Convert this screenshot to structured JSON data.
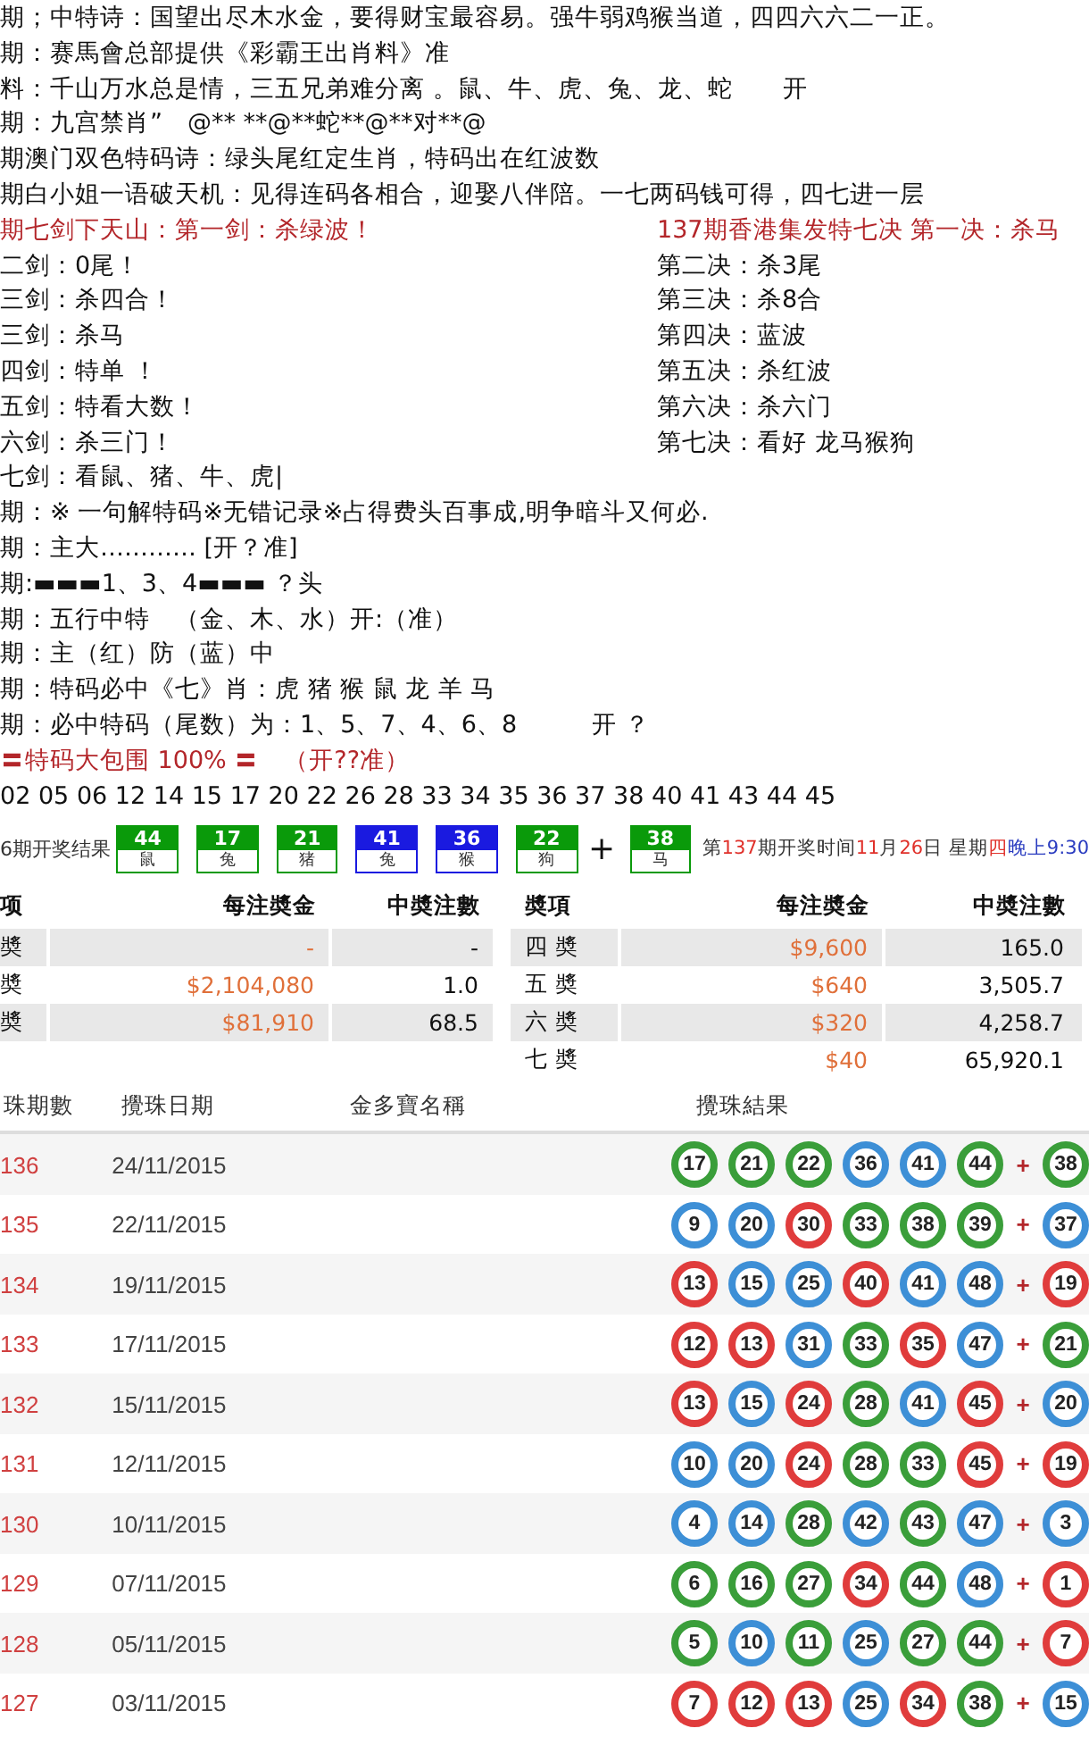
{
  "lines": [
    {
      "kind": "text",
      "text": "期；中特诗：国望出尽木水金，要得财宝最容易。强牛弱鸡猴当道，四四六六二一正。"
    },
    {
      "kind": "text",
      "text": "期：赛馬會总部提供《彩霸王出肖料》准"
    },
    {
      "kind": "text",
      "text": "料：千山万水总是情，三五兄弟难分离 。鼠、牛、虎、兔、龙、蛇　　开"
    },
    {
      "kind": "text",
      "text": "期：九宫禁肖”　@** **@**蛇**@**对**@"
    },
    {
      "kind": "text",
      "text": "期澳门双色特码诗：绿头尾红定生肖，特码出在红波数"
    },
    {
      "kind": "text",
      "text": "期白小姐一语破天机：见得连码各相合，迎娶八伴陪。一七两码钱可得，四七进一层"
    },
    {
      "kind": "alert_pair",
      "left": "期七剑下天山：第一剑：杀绿波！",
      "right": "137期香港集发特七决 第一决：杀马"
    },
    {
      "kind": "pair",
      "left": "二剑：0尾！",
      "right": "第二决：杀3尾"
    },
    {
      "kind": "pair",
      "left": "三剑：杀四合！",
      "right": "第三决：杀8合"
    },
    {
      "kind": "pair",
      "left": "三剑：杀马",
      "right": "第四决：蓝波"
    },
    {
      "kind": "pair",
      "left": "四剑：特单 ！",
      "right": "第五决：杀红波"
    },
    {
      "kind": "pair",
      "left": "五剑：特看大数！",
      "right": "第六决：杀六门"
    },
    {
      "kind": "pair",
      "left": "六剑：杀三门！",
      "right": "第七决：看好 龙马猴狗"
    },
    {
      "kind": "text",
      "text": "七剑：看鼠、猪、牛、虎|"
    },
    {
      "kind": "text",
      "text": "期：※ 一句解特码※无错记录※占得费头百事成,明争暗斗又何必."
    },
    {
      "kind": "text",
      "text": "期：主大………… [开？准]"
    },
    {
      "kind": "text",
      "text": "期:▬▬▬1、3、4▬▬▬ ？头"
    },
    {
      "kind": "text",
      "text": "期：五行中特　（金、木、水）开:（准）"
    },
    {
      "kind": "text",
      "text": "期：主（红）防（蓝）中"
    },
    {
      "kind": "text",
      "text": "期：特码必中《七》肖：虎 猪 猴 鼠 龙 羊 马"
    },
    {
      "kind": "text",
      "text": "期：必中特码（尾数）为：1、5、7、4、6、8　　　开 ？"
    },
    {
      "kind": "alert",
      "text": "〓特码大包围 100% 〓　（开??准）"
    },
    {
      "kind": "text",
      "text": "02 05 06 12 14 15 17 20 22 26 28 33 34 35 36 37 38 40 41 43 44 45"
    }
  ],
  "result": {
    "label": "6期开奖结果",
    "plus": "+",
    "balls": [
      {
        "number": "44",
        "zodiac": "鼠",
        "color": "#0a9a0a",
        "special": false
      },
      {
        "number": "17",
        "zodiac": "兔",
        "color": "#0a9a0a",
        "special": false
      },
      {
        "number": "21",
        "zodiac": "猪",
        "color": "#0a9a0a",
        "special": false
      },
      {
        "number": "41",
        "zodiac": "兔",
        "color": "#1a1ae0",
        "special": false
      },
      {
        "number": "36",
        "zodiac": "猴",
        "color": "#1a1ae0",
        "special": false
      },
      {
        "number": "22",
        "zodiac": "狗",
        "color": "#0a9a0a",
        "special": false
      },
      {
        "number": "38",
        "zodiac": "马",
        "color": "#0a9a0a",
        "special": true
      }
    ],
    "draw_time": [
      {
        "text": "第",
        "color": "#333333"
      },
      {
        "text": "137",
        "color": "#e0302a"
      },
      {
        "text": "期开奖时间",
        "color": "#333333"
      },
      {
        "text": "11",
        "color": "#e0302a"
      },
      {
        "text": "月",
        "color": "#333333"
      },
      {
        "text": "26",
        "color": "#e0302a"
      },
      {
        "text": "日 星期",
        "color": "#333333"
      },
      {
        "text": "四",
        "color": "#e0302a"
      },
      {
        "text": "晚上9:30",
        "color": "#2a3cc0"
      }
    ]
  },
  "prize_tables": [
    {
      "columns": [
        "项",
        "每注奬金",
        "中奬注數"
      ],
      "rows": [
        [
          "奬",
          "-",
          "-"
        ],
        [
          "奬",
          "$2,104,080",
          "1.0"
        ],
        [
          "奬",
          "$81,910",
          "68.5"
        ]
      ]
    },
    {
      "columns": [
        "奬項",
        "每注奬金",
        "中奬注數"
      ],
      "rows": [
        [
          "四 奬",
          "$9,600",
          "165.0"
        ],
        [
          "五 奬",
          "$640",
          "3,505.7"
        ],
        [
          "六 奬",
          "$320",
          "4,258.7"
        ],
        [
          "七 奬",
          "$40",
          "65,920.1"
        ]
      ]
    }
  ],
  "draws": {
    "columns": [
      "珠期數",
      "攪珠日期",
      "金多寶名稱",
      "攪珠結果"
    ],
    "plus": "+",
    "rows": [
      {
        "period": "136",
        "date": "24/11/2015",
        "balls": [
          {
            "number": "17",
            "color": "#3a9e3a"
          },
          {
            "number": "21",
            "color": "#3a9e3a"
          },
          {
            "number": "22",
            "color": "#3a9e3a"
          },
          {
            "number": "36",
            "color": "#3d8fd6"
          },
          {
            "number": "41",
            "color": "#3d8fd6"
          },
          {
            "number": "44",
            "color": "#3a9e3a"
          },
          {
            "number": "38",
            "color": "#3a9e3a"
          }
        ]
      },
      {
        "period": "135",
        "date": "22/11/2015",
        "balls": [
          {
            "number": "9",
            "color": "#3d8fd6"
          },
          {
            "number": "20",
            "color": "#3d8fd6"
          },
          {
            "number": "30",
            "color": "#e03c3c"
          },
          {
            "number": "33",
            "color": "#3a9e3a"
          },
          {
            "number": "38",
            "color": "#3a9e3a"
          },
          {
            "number": "39",
            "color": "#3a9e3a"
          },
          {
            "number": "37",
            "color": "#3d8fd6"
          }
        ]
      },
      {
        "period": "134",
        "date": "19/11/2015",
        "balls": [
          {
            "number": "13",
            "color": "#e03c3c"
          },
          {
            "number": "15",
            "color": "#3d8fd6"
          },
          {
            "number": "25",
            "color": "#3d8fd6"
          },
          {
            "number": "40",
            "color": "#e03c3c"
          },
          {
            "number": "41",
            "color": "#3d8fd6"
          },
          {
            "number": "48",
            "color": "#3d8fd6"
          },
          {
            "number": "19",
            "color": "#e03c3c"
          }
        ]
      },
      {
        "period": "133",
        "date": "17/11/2015",
        "balls": [
          {
            "number": "12",
            "color": "#e03c3c"
          },
          {
            "number": "13",
            "color": "#e03c3c"
          },
          {
            "number": "31",
            "color": "#3d8fd6"
          },
          {
            "number": "33",
            "color": "#3a9e3a"
          },
          {
            "number": "35",
            "color": "#e03c3c"
          },
          {
            "number": "47",
            "color": "#3d8fd6"
          },
          {
            "number": "21",
            "color": "#3a9e3a"
          }
        ]
      },
      {
        "period": "132",
        "date": "15/11/2015",
        "balls": [
          {
            "number": "13",
            "color": "#e03c3c"
          },
          {
            "number": "15",
            "color": "#3d8fd6"
          },
          {
            "number": "24",
            "color": "#e03c3c"
          },
          {
            "number": "28",
            "color": "#3a9e3a"
          },
          {
            "number": "41",
            "color": "#3d8fd6"
          },
          {
            "number": "45",
            "color": "#e03c3c"
          },
          {
            "number": "20",
            "color": "#3d8fd6"
          }
        ]
      },
      {
        "period": "131",
        "date": "12/11/2015",
        "balls": [
          {
            "number": "10",
            "color": "#3d8fd6"
          },
          {
            "number": "20",
            "color": "#3d8fd6"
          },
          {
            "number": "24",
            "color": "#e03c3c"
          },
          {
            "number": "28",
            "color": "#3a9e3a"
          },
          {
            "number": "33",
            "color": "#3a9e3a"
          },
          {
            "number": "45",
            "color": "#e03c3c"
          },
          {
            "number": "19",
            "color": "#e03c3c"
          }
        ]
      },
      {
        "period": "130",
        "date": "10/11/2015",
        "balls": [
          {
            "number": "4",
            "color": "#3d8fd6"
          },
          {
            "number": "14",
            "color": "#3d8fd6"
          },
          {
            "number": "28",
            "color": "#3a9e3a"
          },
          {
            "number": "42",
            "color": "#3d8fd6"
          },
          {
            "number": "43",
            "color": "#3a9e3a"
          },
          {
            "number": "47",
            "color": "#3d8fd6"
          },
          {
            "number": "3",
            "color": "#3d8fd6"
          }
        ]
      },
      {
        "period": "129",
        "date": "07/11/2015",
        "balls": [
          {
            "number": "6",
            "color": "#3a9e3a"
          },
          {
            "number": "16",
            "color": "#3a9e3a"
          },
          {
            "number": "27",
            "color": "#3a9e3a"
          },
          {
            "number": "34",
            "color": "#e03c3c"
          },
          {
            "number": "44",
            "color": "#3a9e3a"
          },
          {
            "number": "48",
            "color": "#3d8fd6"
          },
          {
            "number": "1",
            "color": "#e03c3c"
          }
        ]
      },
      {
        "period": "128",
        "date": "05/11/2015",
        "balls": [
          {
            "number": "5",
            "color": "#3a9e3a"
          },
          {
            "number": "10",
            "color": "#3d8fd6"
          },
          {
            "number": "11",
            "color": "#3a9e3a"
          },
          {
            "number": "25",
            "color": "#3d8fd6"
          },
          {
            "number": "27",
            "color": "#3a9e3a"
          },
          {
            "number": "44",
            "color": "#3a9e3a"
          },
          {
            "number": "7",
            "color": "#e03c3c"
          }
        ]
      },
      {
        "period": "127",
        "date": "03/11/2015",
        "balls": [
          {
            "number": "7",
            "color": "#e03c3c"
          },
          {
            "number": "12",
            "color": "#e03c3c"
          },
          {
            "number": "13",
            "color": "#e03c3c"
          },
          {
            "number": "25",
            "color": "#3d8fd6"
          },
          {
            "number": "34",
            "color": "#e03c3c"
          },
          {
            "number": "38",
            "color": "#3a9e3a"
          },
          {
            "number": "15",
            "color": "#3d8fd6"
          }
        ]
      }
    ]
  }
}
